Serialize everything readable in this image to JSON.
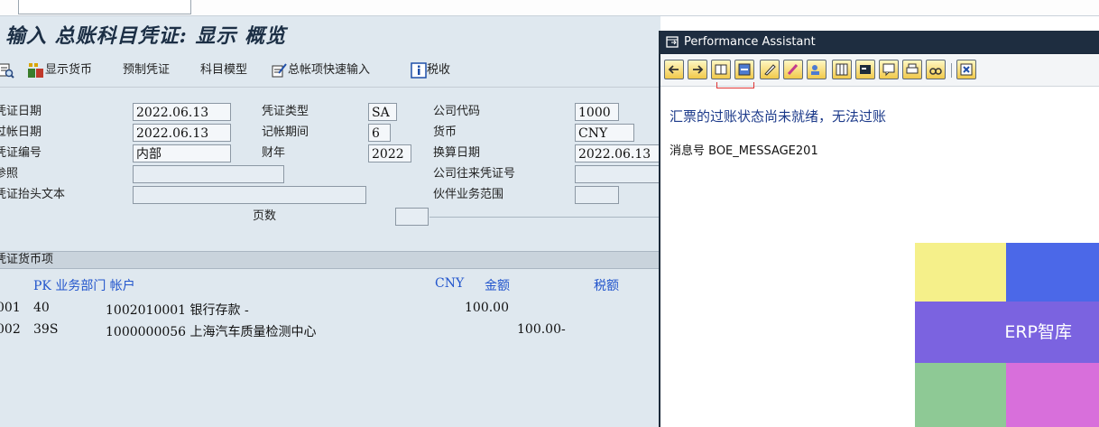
{
  "page_title": "输入 总账科目凭证: 显示 概览",
  "toolbar": {
    "display_currency": "显示货币",
    "park_document": "预制凭证",
    "account_model": "科目模型",
    "gl_fast_entry": "总帐项快速输入",
    "tax": "税收"
  },
  "header_fields": {
    "doc_date": {
      "label": "凭证日期",
      "value": "2022.06.13"
    },
    "doc_type": {
      "label": "凭证类型",
      "value": "SA"
    },
    "company_code": {
      "label": "公司代码",
      "value": "1000"
    },
    "posting_date": {
      "label": "过帐日期",
      "value": "2022.06.13"
    },
    "period": {
      "label": "记帐期间",
      "value": "6"
    },
    "currency": {
      "label": "货币",
      "value": "CNY"
    },
    "doc_number": {
      "label": "凭证编号",
      "value": "内部"
    },
    "fiscal_year": {
      "label": "财年",
      "value": "2022"
    },
    "translation_date": {
      "label": "换算日期",
      "value": "2022.06.13"
    },
    "reference": {
      "label": "参照",
      "value": ""
    },
    "intercompany_doc": {
      "label": "公司往来凭证号",
      "value": ""
    },
    "header_text": {
      "label": "凭证抬头文本",
      "value": ""
    },
    "trading_partner_ba": {
      "label": "伙伴业务范围",
      "value": ""
    },
    "pages": {
      "label": "页数",
      "value": ""
    }
  },
  "items_section": {
    "title": "凭证货币项",
    "columns": {
      "pk_ba_account": "PK 业务部门 帐户",
      "currency": "CNY",
      "amount": "金额",
      "tax_amount": "税额"
    },
    "rows": [
      {
        "item": "001",
        "pk": "40",
        "account": "1002010001 银行存款 -",
        "amount": "100.00",
        "credit": ""
      },
      {
        "item": "002",
        "pk": "39S",
        "account": "1000000056 上海汽车质量检测中心",
        "amount": "",
        "credit": "100.00-"
      }
    ]
  },
  "assistant": {
    "title": "Performance Assistant",
    "message": "汇票的过账状态尚未就绪，无法过账",
    "message_no": "消息号 BOE_MESSAGE201"
  },
  "watermark": {
    "text": "ERP智库",
    "colors": {
      "yellow": "#f5f08a",
      "blue": "#4b68e8",
      "purple": "#7b63e0",
      "green": "#8ec995",
      "pink": "#d86fdb"
    }
  }
}
